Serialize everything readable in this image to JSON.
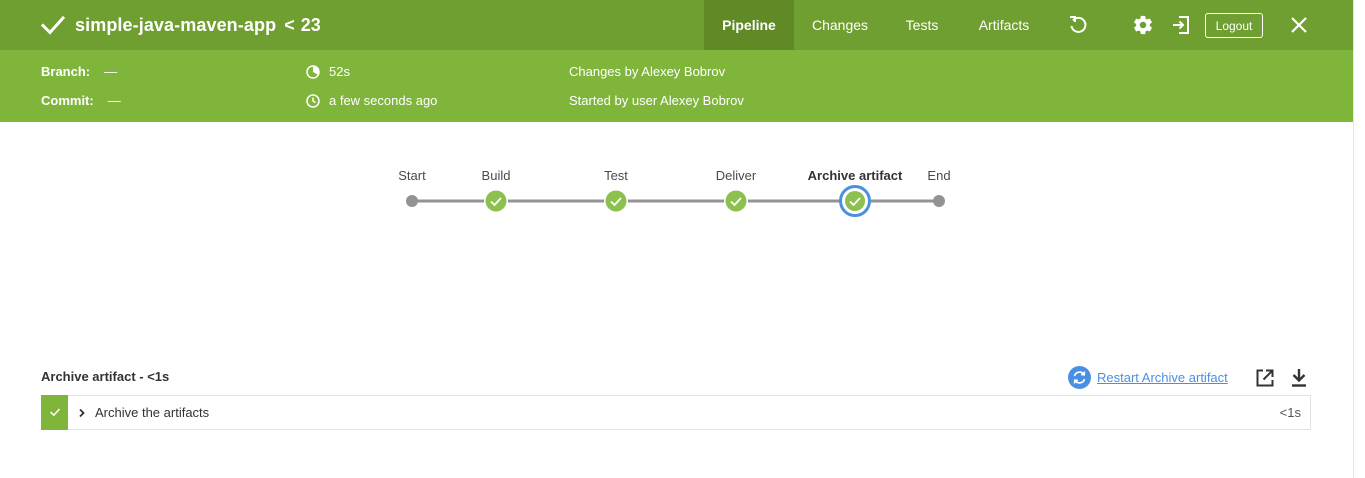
{
  "header": {
    "pipeline_name": "simple-java-maven-app",
    "separator": "<",
    "run_number": "23",
    "nav": {
      "pipeline": "Pipeline",
      "changes": "Changes",
      "tests": "Tests",
      "artifacts": "Artifacts"
    },
    "logout": "Logout",
    "icons": [
      "checkmark-icon",
      "replay-icon",
      "gear-icon",
      "exit-classic-icon",
      "close-icon"
    ]
  },
  "summary": {
    "branch_label": "Branch:",
    "branch_value": "—",
    "commit_label": "Commit:",
    "commit_value": "—",
    "duration": "52s",
    "started_ago": "a few seconds ago",
    "changes": "Changes by Alexey Bobrov",
    "started_by": "Started by user Alexey Bobrov"
  },
  "pipeline_graph": {
    "stages": [
      {
        "name": "Start",
        "status": "none"
      },
      {
        "name": "Build",
        "status": "success"
      },
      {
        "name": "Test",
        "status": "success"
      },
      {
        "name": "Deliver",
        "status": "success"
      },
      {
        "name": "Archive artifact",
        "status": "success",
        "selected": true
      },
      {
        "name": "End",
        "status": "none"
      }
    ]
  },
  "step_panel": {
    "title": "Archive artifact - <1s",
    "restart_label": "Restart Archive artifact",
    "steps": [
      {
        "name": "Archive the artifacts",
        "duration": "<1s",
        "status": "success"
      }
    ]
  },
  "colors": {
    "header_bg": "#6f9e31",
    "subheader_bg": "#80b53b",
    "success": "#80b53b",
    "accent": "#4a90e2"
  }
}
